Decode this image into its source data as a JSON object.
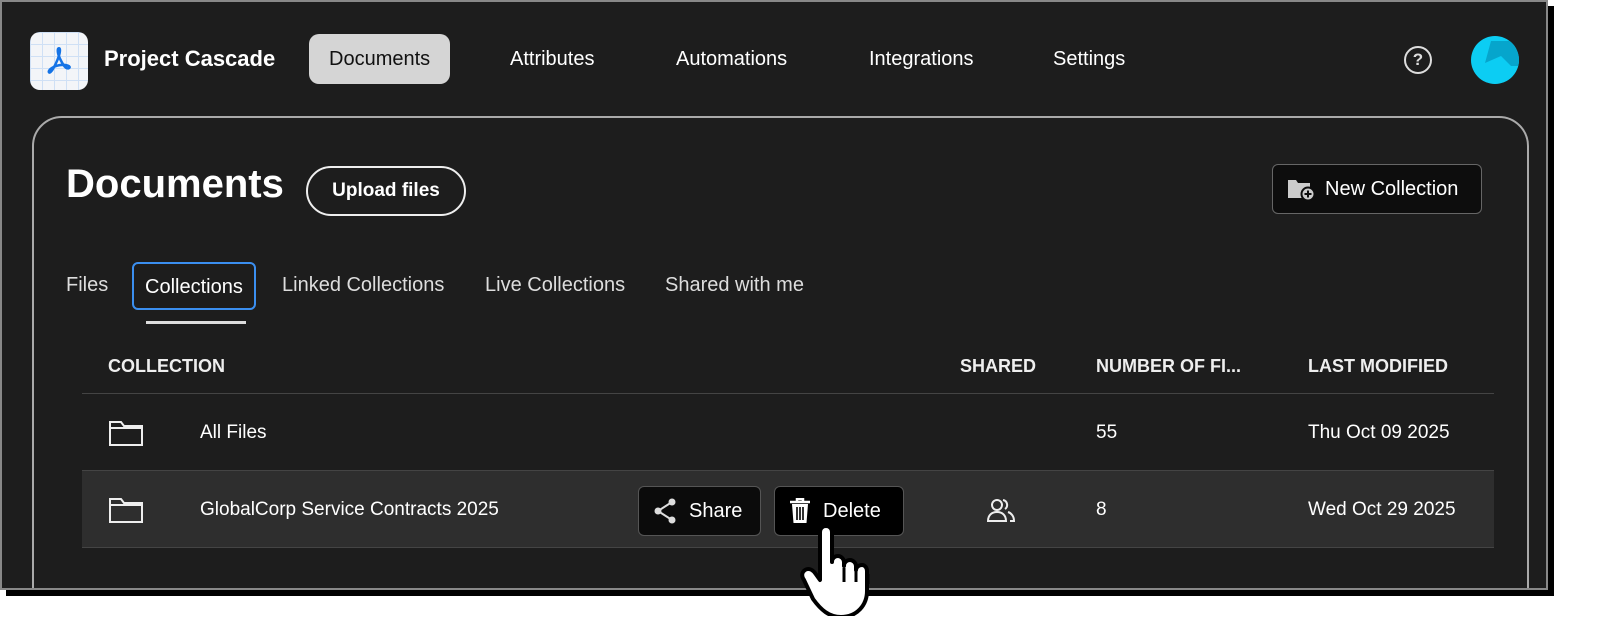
{
  "app": {
    "title": "Project Cascade"
  },
  "nav": [
    {
      "label": "Documents",
      "active": true
    },
    {
      "label": "Attributes"
    },
    {
      "label": "Automations"
    },
    {
      "label": "Integrations"
    },
    {
      "label": "Settings"
    }
  ],
  "page": {
    "title": "Documents",
    "upload_label": "Upload files",
    "new_collection_label": "New Collection"
  },
  "tabs": [
    {
      "label": "Files"
    },
    {
      "label": "Collections",
      "active": true
    },
    {
      "label": "Linked Collections"
    },
    {
      "label": "Live Collections"
    },
    {
      "label": "Shared with me"
    }
  ],
  "table": {
    "headers": {
      "collection": "COLLECTION",
      "shared": "SHARED",
      "files": "NUMBER OF FI...",
      "modified": "LAST MODIFIED"
    },
    "rows": [
      {
        "name": "All Files",
        "files": "55",
        "modified": "Thu Oct 09 2025"
      },
      {
        "name": "GlobalCorp Service Contracts 2025",
        "files": "8",
        "modified": "Wed Oct 29 2025",
        "shared": true
      }
    ],
    "row_actions": {
      "share": "Share",
      "delete": "Delete"
    }
  },
  "colors": {
    "accent": "#3b8ff0",
    "avatar": "#0ccdf3",
    "logo": "#1473e6"
  }
}
